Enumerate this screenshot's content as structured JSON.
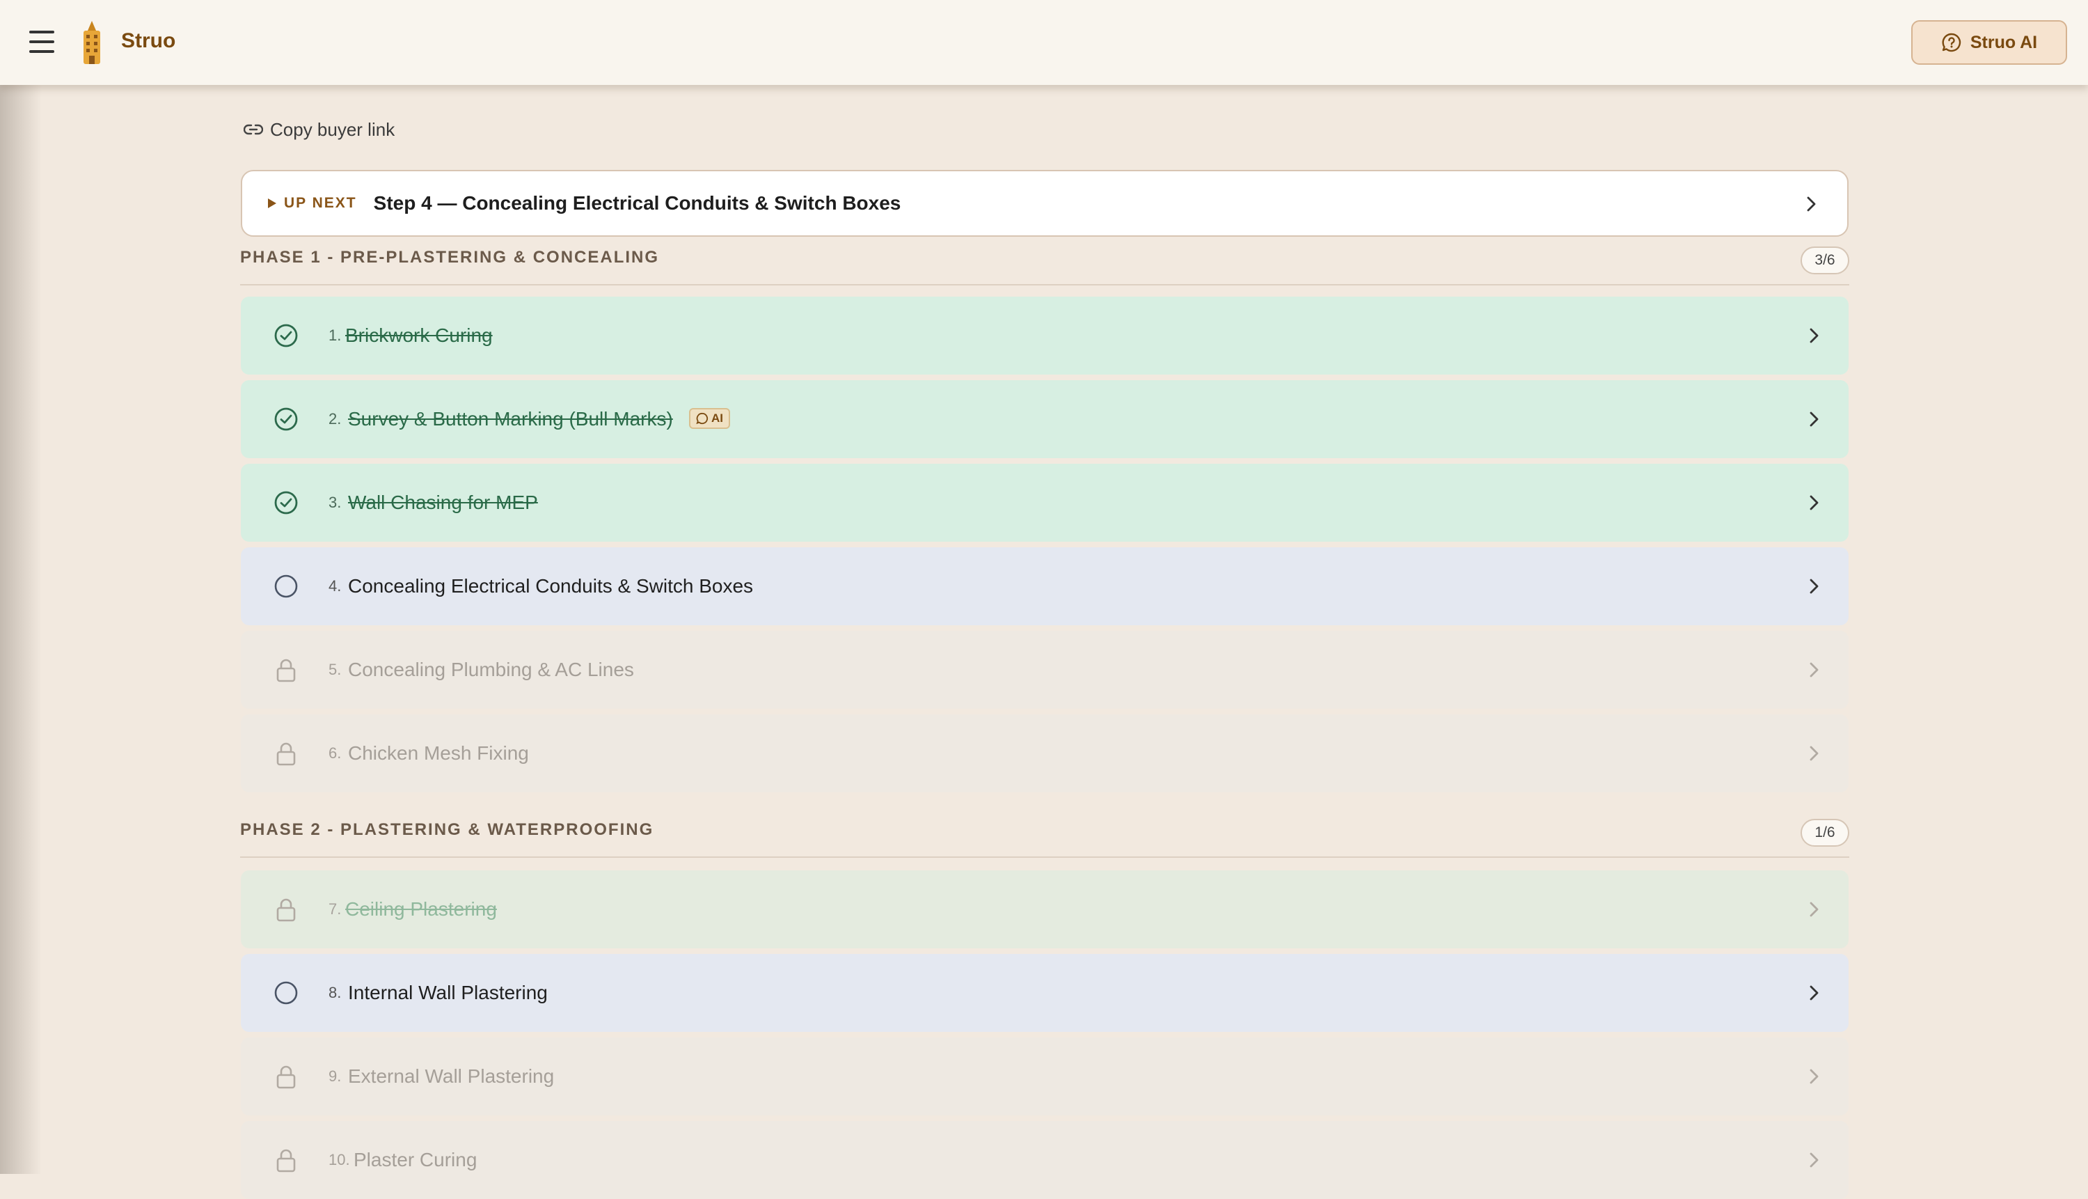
{
  "header": {
    "brand": "Struo",
    "ai_button_label": "Struo AI"
  },
  "copy_link_label": "Copy buyer link",
  "up_next": {
    "tag": "UP NEXT",
    "title": "Step 4 — Concealing Electrical Conduits & Switch Boxes"
  },
  "phases": [
    {
      "title": "PHASE 1 - PRE-PLASTERING & CONCEALING",
      "count": "3/6",
      "steps": [
        {
          "num": "1.",
          "label": "Brickwork Curing",
          "status": "done"
        },
        {
          "num": "2.",
          "label": "Survey & Button Marking (Bull Marks)",
          "status": "done",
          "badge": "AI"
        },
        {
          "num": "3.",
          "label": "Wall Chasing for MEP",
          "status": "done"
        },
        {
          "num": "4.",
          "label": "Concealing Electrical Conduits & Switch Boxes",
          "status": "current"
        },
        {
          "num": "5.",
          "label": "Concealing Plumbing & AC Lines",
          "status": "locked"
        },
        {
          "num": "6.",
          "label": "Chicken Mesh Fixing",
          "status": "locked"
        }
      ]
    },
    {
      "title": "PHASE 2 - PLASTERING & WATERPROOFING",
      "count": "1/6",
      "steps": [
        {
          "num": "7.",
          "label": "Ceiling Plastering",
          "status": "done-locked"
        },
        {
          "num": "8.",
          "label": "Internal Wall Plastering",
          "status": "current"
        },
        {
          "num": "9.",
          "label": "External Wall Plastering",
          "status": "locked"
        },
        {
          "num": "10.",
          "label": "Plaster Curing",
          "status": "locked"
        }
      ]
    }
  ],
  "colors": {
    "accent": "#7a4a10",
    "done_bg": "#d7efe2",
    "current_bg": "#e4e8f1",
    "locked_bg": "#eee9e2"
  }
}
